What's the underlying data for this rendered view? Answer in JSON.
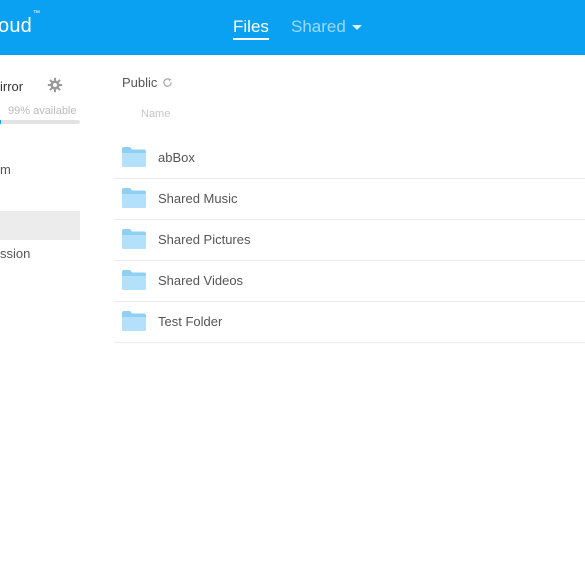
{
  "header": {
    "brand": "oud",
    "brand_mark": "™",
    "tabs": [
      {
        "label": "Files",
        "active": true
      },
      {
        "label": "Shared",
        "active": false
      }
    ],
    "color": "#0aa1f2"
  },
  "sidebar": {
    "account_name": "irror",
    "storage_available": "99% available",
    "storage_used_fraction": 0.01,
    "items": [
      {
        "label": "m",
        "selected": false
      },
      {
        "label": "",
        "selected": true
      },
      {
        "label": "ssion",
        "selected": false
      }
    ]
  },
  "main": {
    "breadcrumb": "Public",
    "column_header": "Name",
    "files": [
      {
        "name": "abBox",
        "icon": "folder-icon"
      },
      {
        "name": "Shared Music",
        "icon": "folder-icon"
      },
      {
        "name": "Shared Pictures",
        "icon": "folder-icon"
      },
      {
        "name": "Shared Videos",
        "icon": "folder-icon"
      },
      {
        "name": "Test Folder",
        "icon": "folder-icon"
      }
    ]
  }
}
